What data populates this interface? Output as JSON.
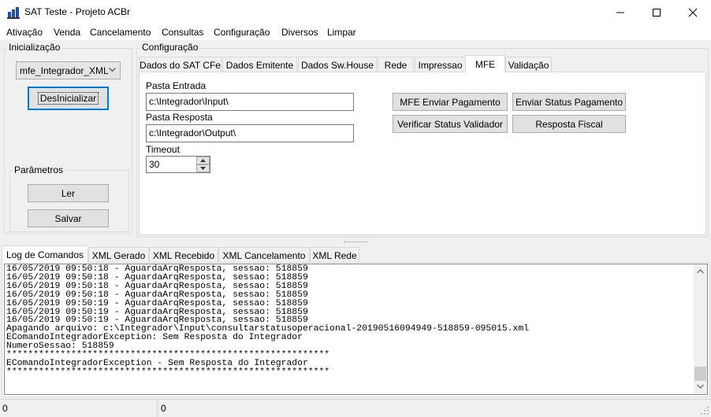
{
  "window": {
    "title": "SAT Teste - Projeto ACBr",
    "icon": "sat-app-icon"
  },
  "window_controls": {
    "minimize": "—",
    "maximize": "☐",
    "close": "✕"
  },
  "menu": [
    "Ativação",
    "Venda",
    "Cancelamento",
    "Consultas",
    "Configuração",
    "Diversos",
    "Limpar"
  ],
  "init_group": {
    "label": "Inicialização",
    "select_value": "mfe_Integrador_XML",
    "deinit_button": "DesInicializar"
  },
  "params_group": {
    "label": "Parâmetros",
    "ler_button": "Ler",
    "salvar_button": "Salvar"
  },
  "config_group": {
    "label": "Configuração",
    "tabs": [
      "Dados do SAT CFe",
      "Dados Emitente",
      "Dados Sw.House",
      "Rede",
      "Impressao",
      "MFE",
      "Validação"
    ],
    "active_tab": "MFE",
    "pasta_entrada_label": "Pasta Entrada",
    "pasta_entrada_value": "c:\\Integrador\\Input\\",
    "pasta_resposta_label": "Pasta Resposta",
    "pasta_resposta_value": "c:\\Integrador\\Output\\",
    "timeout_label": "Timeout",
    "timeout_value": "30",
    "buttons": {
      "mfe_enviar_pagamento": "MFE Enviar Pagamento",
      "enviar_status_pagamento": "Enviar Status Pagamento",
      "verificar_status_validador": "Verificar Status Validador",
      "resposta_fiscal": "Resposta Fiscal"
    }
  },
  "log_tabs": [
    "Log de Comandos",
    "XML Gerado",
    "XML Recebido",
    "XML Cancelamento",
    "XML Rede"
  ],
  "active_log_tab": "Log de Comandos",
  "log_text": "16/05/2019 09:50:18 - AguardaArqResposta, sessao: 518859\n16/05/2019 09:50:18 - AguardaArqResposta, sessao: 518859\n16/05/2019 09:50:18 - AguardaArqResposta, sessao: 518859\n16/05/2019 09:50:18 - AguardaArqResposta, sessao: 518859\n16/05/2019 09:50:19 - AguardaArqResposta, sessao: 518859\n16/05/2019 09:50:19 - AguardaArqResposta, sessao: 518859\n16/05/2019 09:50:19 - AguardaArqResposta, sessao: 518859\nApagando arquivo: c:\\Integrador\\Input\\consultarstatusoperacional-20190516094949-518859-095015.xml\nEComandoIntegradorException: Sem Resposta do Integrador\nNumeroSessao: 518859\n************************************************************\nEComandoIntegradorException - Sem Resposta do Integrador\n************************************************************",
  "status_bar": {
    "panel1": "0",
    "panel2": "0"
  }
}
